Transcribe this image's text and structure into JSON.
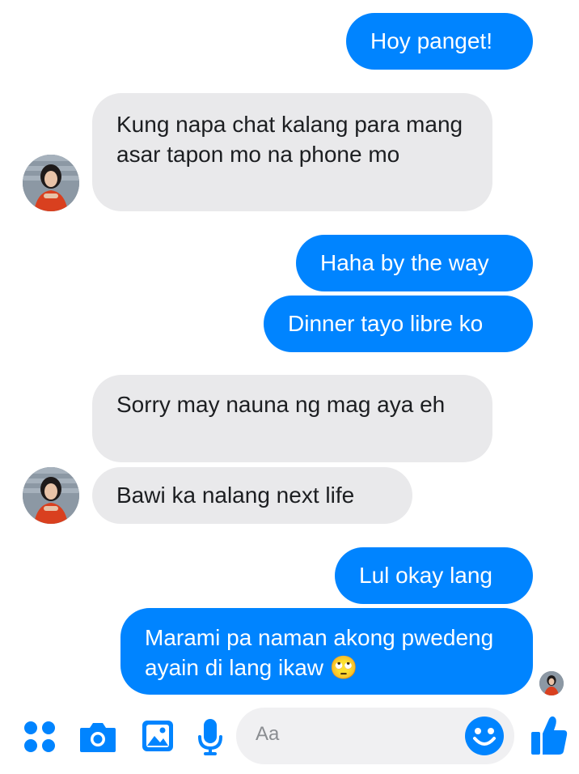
{
  "messages": [
    {
      "side": "out",
      "text": "Hoy panget!"
    },
    {
      "side": "in",
      "text": "Kung napa chat kalang para mang asar tapon mo na phone mo"
    },
    {
      "side": "out",
      "text": "Haha by the way"
    },
    {
      "side": "out",
      "text": "Dinner tayo libre ko"
    },
    {
      "side": "in",
      "text": "Sorry may nauna ng mag aya eh"
    },
    {
      "side": "in",
      "text": "Bawi ka nalang next life"
    },
    {
      "side": "out",
      "text": "Lul okay lang"
    },
    {
      "side": "out",
      "text": "Marami pa naman akong pwedeng ayain di lang ikaw 🙄"
    }
  ],
  "composer": {
    "placeholder": "Aa"
  },
  "icons": {
    "apps": "apps-icon",
    "camera": "camera-icon",
    "gallery": "gallery-icon",
    "mic": "microphone-icon",
    "emoji": "emoji-icon",
    "like": "thumbs-up-icon"
  },
  "colors": {
    "accent": "#0084ff",
    "incoming": "#e9e9eb",
    "outgoing_text": "#ffffff",
    "incoming_text": "#1c1e21"
  }
}
